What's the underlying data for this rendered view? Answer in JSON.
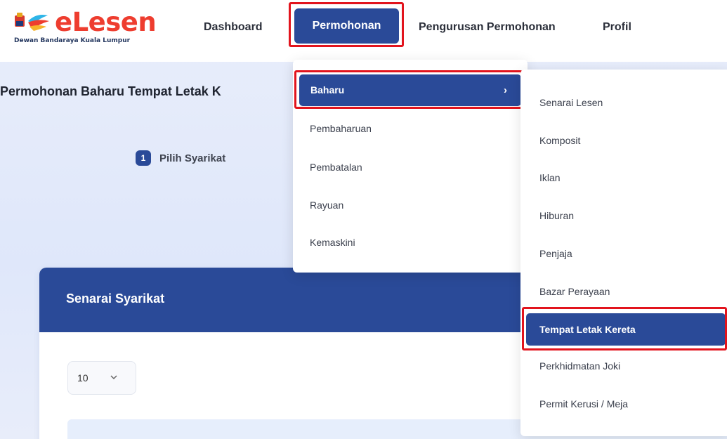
{
  "logo": {
    "name": "eLesen",
    "subtitle": "Dewan Bandaraya Kuala Lumpur",
    "colors": {
      "word": "#ee3d2f",
      "subtitle": "#23365e"
    }
  },
  "nav": {
    "dashboard": "Dashboard",
    "permohonan": "Permohonan",
    "pengurusan": "Pengurusan Permohonan",
    "profil": "Profil"
  },
  "page": {
    "title": "Permohonan Baharu Tempat Letak K"
  },
  "stepper": {
    "number": "1",
    "label": "Pilih Syarikat"
  },
  "card": {
    "title": "Senarai Syarikat",
    "page_size": "10"
  },
  "menu1": {
    "items": [
      "Baharu",
      "Pembaharuan",
      "Pembatalan",
      "Rayuan",
      "Kemaskini"
    ]
  },
  "menu2": {
    "items": [
      "Senarai Lesen",
      "Komposit",
      "Iklan",
      "Hiburan",
      "Penjaja",
      "Bazar Perayaan",
      "Tempat Letak Kereta",
      "Perkhidmatan Joki",
      "Permit Kerusi / Meja"
    ]
  },
  "colors": {
    "primary": "#2a4a98",
    "highlight": "#e2141d",
    "background": "#e4ebfa"
  },
  "icons": {
    "logo_mark": "elesen-logo-icon",
    "chevron_right": "chevron-right-icon",
    "chevron_down": "chevron-down-icon"
  }
}
